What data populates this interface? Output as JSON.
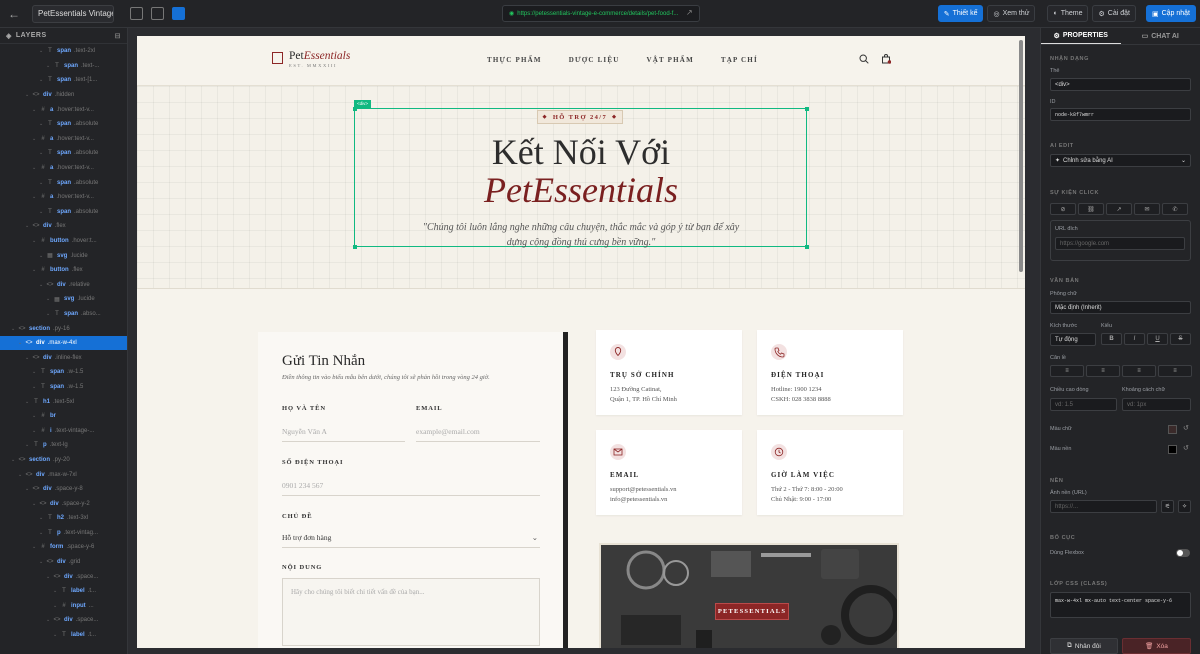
{
  "topbar": {
    "project": "PetEssentials Vintage ...",
    "url": "https://petessentials-vintage-e-commerce/details/pet-food-f...",
    "design_btn": "Thiết kế",
    "preview_btn": "Xem thử",
    "theme_btn": "Theme",
    "settings_btn": "Cài đặt",
    "update_btn": "Cập nhật"
  },
  "layers": {
    "title": "LAYERS",
    "rows": [
      {
        "indent": 5,
        "icon": "T",
        "tag": "span",
        "cls": ".text-2xl"
      },
      {
        "indent": 6,
        "icon": "T",
        "tag": "span",
        "cls": ".text-..."
      },
      {
        "indent": 5,
        "icon": "T",
        "tag": "span",
        "cls": ".text-[1..."
      },
      {
        "indent": 3,
        "icon": "<>",
        "tag": "div",
        "cls": ".hidden"
      },
      {
        "indent": 4,
        "icon": "#",
        "tag": "a",
        "cls": ".hover:text-v..."
      },
      {
        "indent": 5,
        "icon": "T",
        "tag": "span",
        "cls": ".absolute"
      },
      {
        "indent": 4,
        "icon": "#",
        "tag": "a",
        "cls": ".hover:text-v..."
      },
      {
        "indent": 5,
        "icon": "T",
        "tag": "span",
        "cls": ".absolute"
      },
      {
        "indent": 4,
        "icon": "#",
        "tag": "a",
        "cls": ".hover:text-v..."
      },
      {
        "indent": 5,
        "icon": "T",
        "tag": "span",
        "cls": ".absolute"
      },
      {
        "indent": 4,
        "icon": "#",
        "tag": "a",
        "cls": ".hover:text-v..."
      },
      {
        "indent": 5,
        "icon": "T",
        "tag": "span",
        "cls": ".absolute"
      },
      {
        "indent": 3,
        "icon": "<>",
        "tag": "div",
        "cls": ".flex"
      },
      {
        "indent": 4,
        "icon": "#",
        "tag": "button",
        "cls": ".hover:t..."
      },
      {
        "indent": 5,
        "icon": "▦",
        "tag": "svg",
        "cls": ".lucide"
      },
      {
        "indent": 4,
        "icon": "#",
        "tag": "button",
        "cls": ".flex"
      },
      {
        "indent": 5,
        "icon": "<>",
        "tag": "div",
        "cls": ".relative"
      },
      {
        "indent": 6,
        "icon": "▦",
        "tag": "svg",
        "cls": ".lucide"
      },
      {
        "indent": 6,
        "icon": "T",
        "tag": "span",
        "cls": ".abso..."
      },
      {
        "indent": 1,
        "icon": "<>",
        "tag": "section",
        "cls": ".py-16"
      },
      {
        "indent": 2,
        "icon": "<>",
        "tag": "div",
        "cls": ".max-w-4xl",
        "sel": true
      },
      {
        "indent": 3,
        "icon": "<>",
        "tag": "div",
        "cls": ".inline-flex"
      },
      {
        "indent": 4,
        "icon": "T",
        "tag": "span",
        "cls": ".w-1.5"
      },
      {
        "indent": 4,
        "icon": "T",
        "tag": "span",
        "cls": ".w-1.5"
      },
      {
        "indent": 3,
        "icon": "T",
        "tag": "h1",
        "cls": ".text-5xl"
      },
      {
        "indent": 4,
        "icon": "#",
        "tag": "br",
        "cls": ""
      },
      {
        "indent": 4,
        "icon": "#",
        "tag": "i",
        "cls": ".text-vintage-..."
      },
      {
        "indent": 3,
        "icon": "T",
        "tag": "p",
        "cls": ".text-lg"
      },
      {
        "indent": 1,
        "icon": "<>",
        "tag": "section",
        "cls": ".py-20"
      },
      {
        "indent": 2,
        "icon": "<>",
        "tag": "div",
        "cls": ".max-w-7xl"
      },
      {
        "indent": 3,
        "icon": "<>",
        "tag": "div",
        "cls": ".space-y-8"
      },
      {
        "indent": 4,
        "icon": "<>",
        "tag": "div",
        "cls": ".space-y-2"
      },
      {
        "indent": 5,
        "icon": "T",
        "tag": "h2",
        "cls": ".text-3xl"
      },
      {
        "indent": 5,
        "icon": "T",
        "tag": "p",
        "cls": ".text-vintag..."
      },
      {
        "indent": 4,
        "icon": "#",
        "tag": "form",
        "cls": ".space-y-6"
      },
      {
        "indent": 5,
        "icon": "<>",
        "tag": "div",
        "cls": ".grid"
      },
      {
        "indent": 6,
        "icon": "<>",
        "tag": "div",
        "cls": ".space..."
      },
      {
        "indent": 7,
        "icon": "T",
        "tag": "label",
        "cls": ".t..."
      },
      {
        "indent": 7,
        "icon": "#",
        "tag": "input",
        "cls": "..."
      },
      {
        "indent": 6,
        "icon": "<>",
        "tag": "div",
        "cls": ".space..."
      },
      {
        "indent": 7,
        "icon": "T",
        "tag": "label",
        "cls": ".t..."
      }
    ]
  },
  "site": {
    "logo_main": "Pet",
    "logo_italic": "Essentials",
    "logo_sub": "EST. MMXXIII",
    "menu": [
      "THỰC PHẨM",
      "DƯỢC LIỆU",
      "VẬT PHẨM",
      "TẠP CHÍ"
    ],
    "selected_tag": "<div>",
    "badge": "HỖ TRỢ 24/7",
    "heading_line1": "Kết Nối Với",
    "heading_line2": "PetEssentials",
    "quote": "\"Chúng tôi luôn lắng nghe những câu chuyện, thắc mắc và góp ý từ bạn để xây dựng cộng đồng thú cưng bền vững.\"",
    "form": {
      "title": "Gửi Tin Nhắn",
      "subtitle": "Điền thông tin vào biểu mẫu bên dưới, chúng tôi sẽ phản hồi trong vòng 24 giờ.",
      "name_label": "HỌ VÀ TÊN",
      "name_ph": "Nguyễn Văn A",
      "email_label": "EMAIL",
      "email_ph": "example@email.com",
      "phone_label": "SỐ ĐIỆN THOẠI",
      "phone_ph": "0901 234 567",
      "subject_label": "CHỦ ĐỀ",
      "subject_value": "Hỗ trợ đơn hàng",
      "message_label": "NỘI DUNG",
      "message_ph": "Hãy cho chúng tôi biết chi tiết vấn đề của bạn..."
    },
    "cards": [
      {
        "title": "TRỤ SỞ CHÍNH",
        "l1": "123 Đường Catinat,",
        "l2": "Quận 1, TP. Hồ Chí Minh",
        "icon": "map-pin-icon"
      },
      {
        "title": "ĐIỆN THOẠI",
        "l1": "Hotline: 1900 1234",
        "l2": "CSKH: 028 3838 8888",
        "icon": "phone-icon"
      },
      {
        "title": "EMAIL",
        "l1": "support@petessentials.vn",
        "l2": "info@petessentials.vn",
        "icon": "mail-icon"
      },
      {
        "title": "GIỜ LÀM VIỆC",
        "l1": "Thứ 2 - Thứ 7: 8:00 - 20:00",
        "l2": "Chủ Nhật: 9:00 - 17:00",
        "icon": "clock-icon"
      }
    ],
    "photo_badge": "PETESSENTIALS"
  },
  "props": {
    "tab1": "PROPERTIES",
    "tab2": "CHAT AI",
    "sec_ident": "NHẬN DẠNG",
    "tag_label": "Thẻ",
    "tag_value": "<div>",
    "id_label": "ID",
    "id_value": "node-k8f7wmrr",
    "sec_ai": "AI EDIT",
    "ai_value": "Chỉnh sửa bằng AI",
    "sec_click": "SỰ KIỆN CLICK",
    "url_label": "URL đích",
    "url_ph": "https://google.com",
    "sec_text": "VĂN BẢN",
    "font_label": "Phông chữ",
    "font_value": "Mặc định (Inherit)",
    "size_label": "Kích thước",
    "style_label": "Kiểu",
    "size_value": "Tự động",
    "align_label": "Căn lề",
    "lh_label": "Chiều cao dòng",
    "ls_label": "Khoảng cách chữ",
    "lh_ph": "vd: 1.5",
    "ls_ph": "vd: 1px",
    "color_label": "Màu chữ",
    "bg_label": "Màu nền",
    "sec_bg": "NỀN",
    "bgimg_label": "Ảnh nền (URL)",
    "bgimg_ph": "https://...",
    "sec_layout": "BỐ CỤC",
    "flex_label": "Dùng Flexbox",
    "sec_css": "LỚP CSS (CLASS)",
    "css_value": "max-w-4xl mx-auto text-center space-y-6",
    "dup_btn": "Nhân đôi",
    "del_btn": "Xóa",
    "text_color": "#3a2a2a",
    "bg_color": "#000000"
  }
}
